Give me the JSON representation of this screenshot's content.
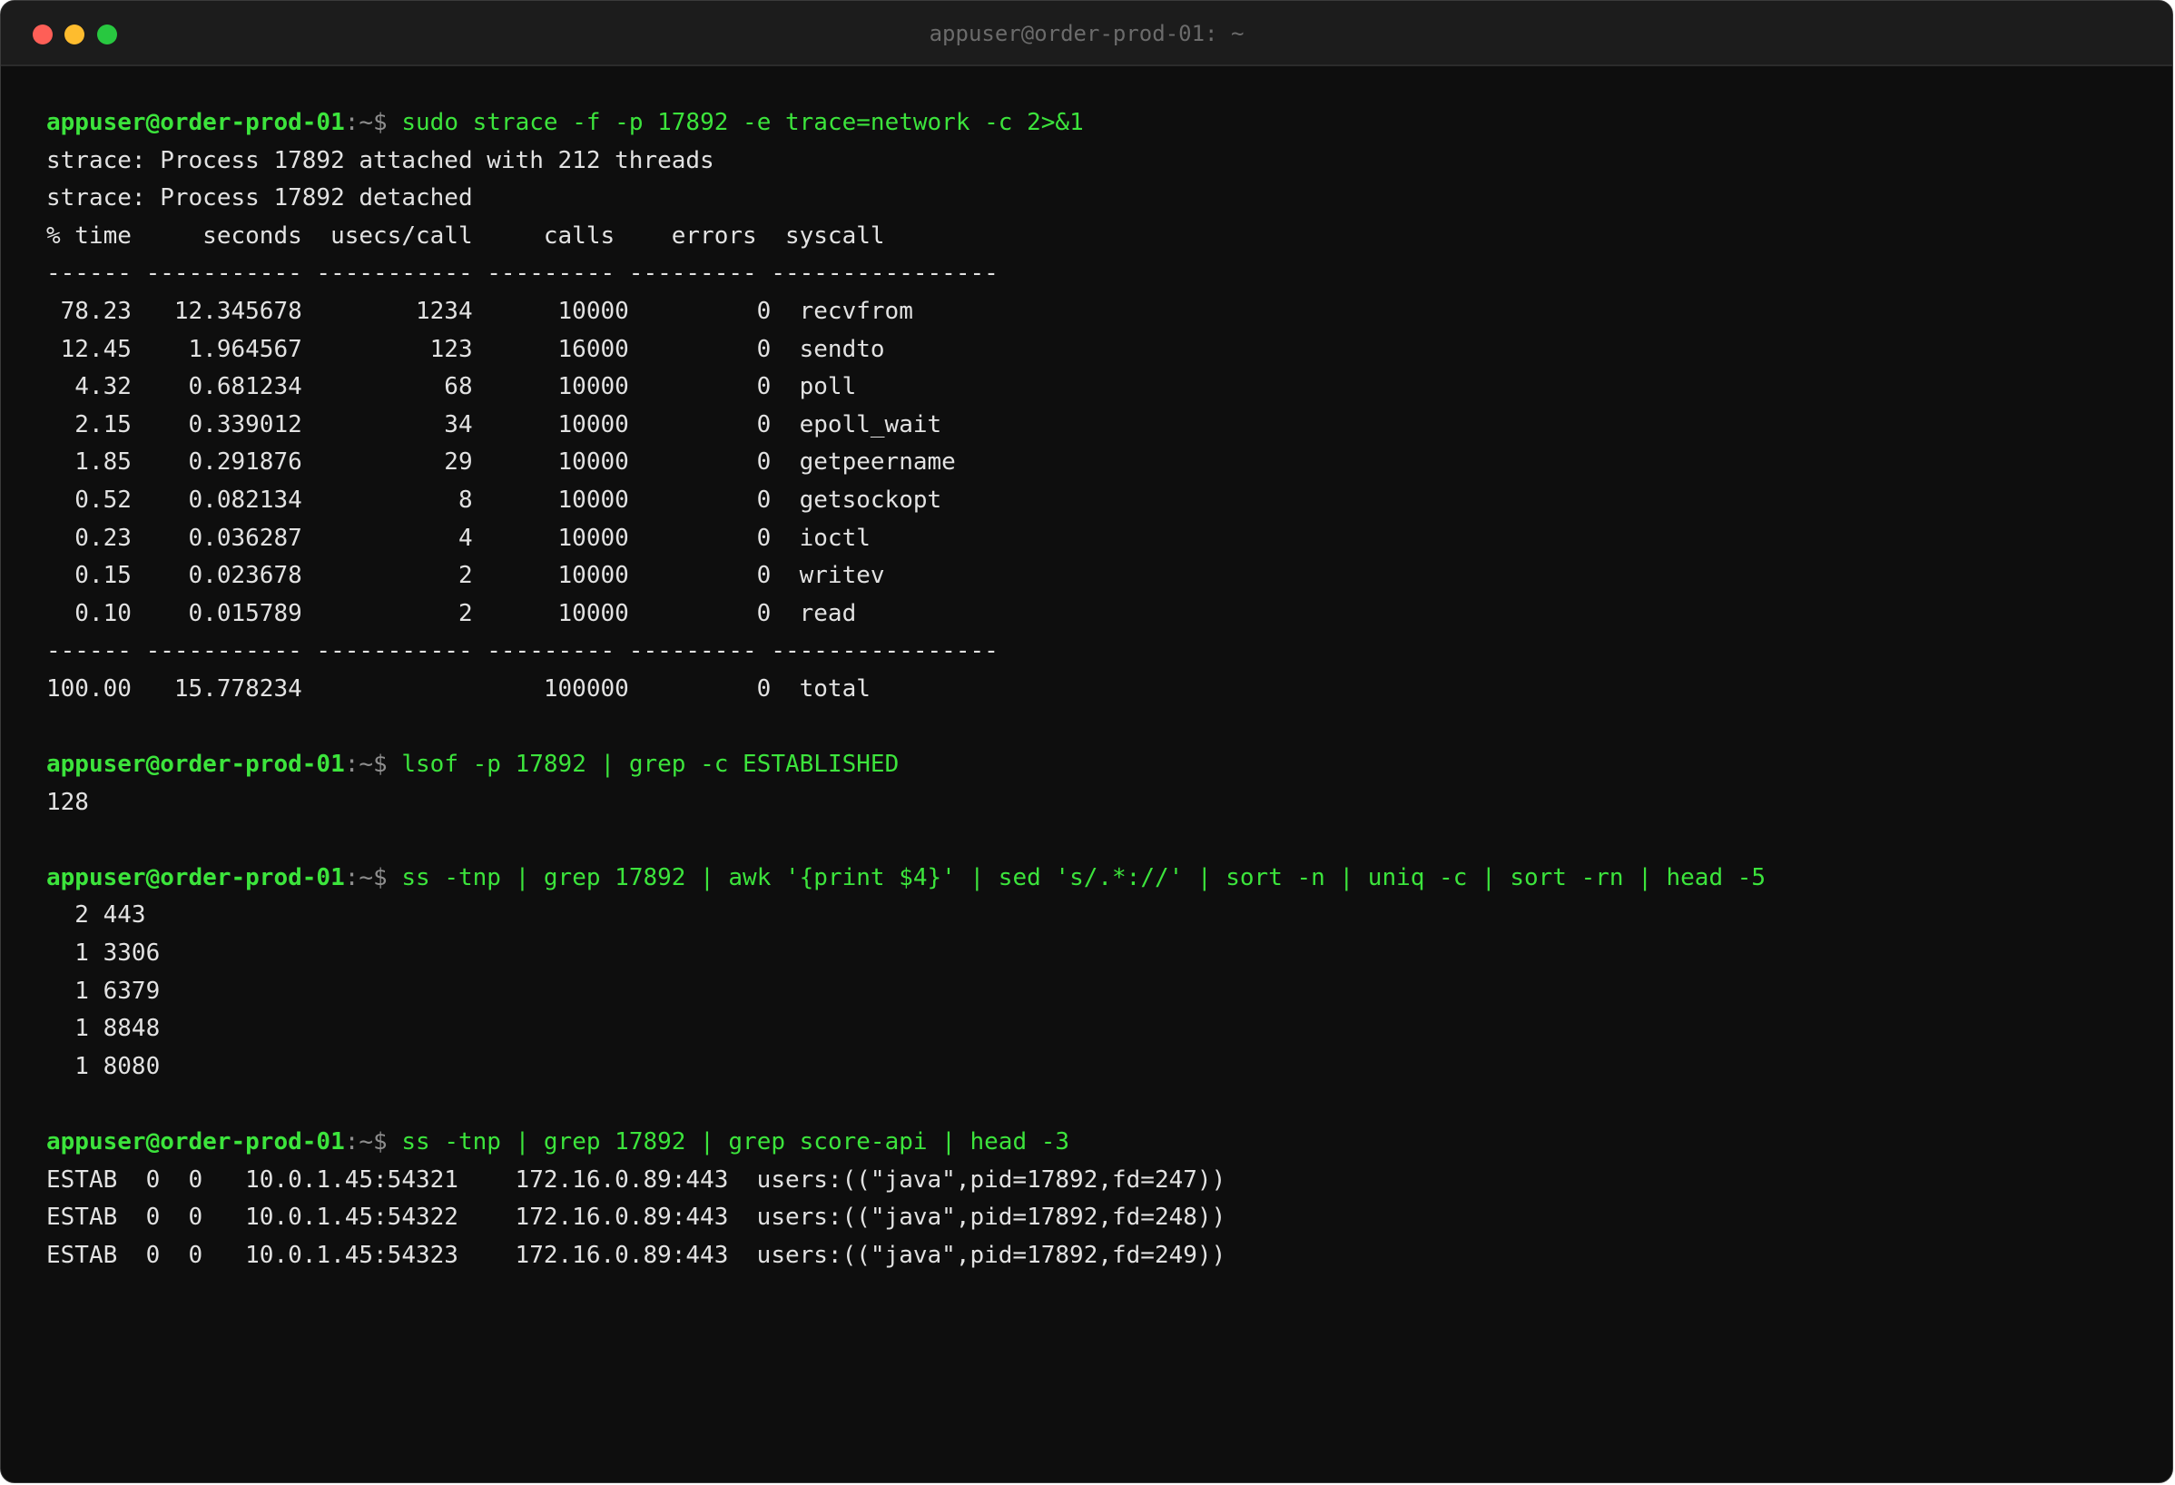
{
  "window": {
    "title": "appuser@order-prod-01: ~"
  },
  "prompt": {
    "user_host": "appuser@order-prod-01",
    "path_symbol": ":~$"
  },
  "blocks": [
    {
      "command": "sudo strace -f -p 17892 -e trace=network -c 2>&1",
      "output": [
        "strace: Process 17892 attached with 212 threads",
        "strace: Process 17892 detached",
        "% time     seconds  usecs/call     calls    errors  syscall",
        "------ ----------- ----------- --------- --------- ----------------",
        " 78.23   12.345678        1234      10000         0  recvfrom",
        " 12.45    1.964567         123      16000         0  sendto",
        "  4.32    0.681234          68      10000         0  poll",
        "  2.15    0.339012          34      10000         0  epoll_wait",
        "  1.85    0.291876          29      10000         0  getpeername",
        "  0.52    0.082134           8      10000         0  getsockopt",
        "  0.23    0.036287           4      10000         0  ioctl",
        "  0.15    0.023678           2      10000         0  writev",
        "  0.10    0.015789           2      10000         0  read",
        "------ ----------- ----------- --------- --------- ----------------",
        "100.00   15.778234                 100000         0  total"
      ]
    },
    {
      "command": "lsof -p 17892 | grep -c ESTABLISHED",
      "output": [
        "128"
      ]
    },
    {
      "command": "ss -tnp | grep 17892 | awk '{print $4}' | sed 's/.*://' | sort -n | uniq -c | sort -rn | head -5",
      "output": [
        "  2 443",
        "  1 3306",
        "  1 6379",
        "  1 8848",
        "  1 8080"
      ]
    },
    {
      "command": "ss -tnp | grep 17892 | grep score-api | head -3",
      "output": [
        "ESTAB  0  0   10.0.1.45:54321    172.16.0.89:443  users:((\"java\",pid=17892,fd=247))",
        "ESTAB  0  0   10.0.1.45:54322    172.16.0.89:443  users:((\"java\",pid=17892,fd=248))",
        "ESTAB  0  0   10.0.1.45:54323    172.16.0.89:443  users:((\"java\",pid=17892,fd=249))"
      ]
    }
  ]
}
